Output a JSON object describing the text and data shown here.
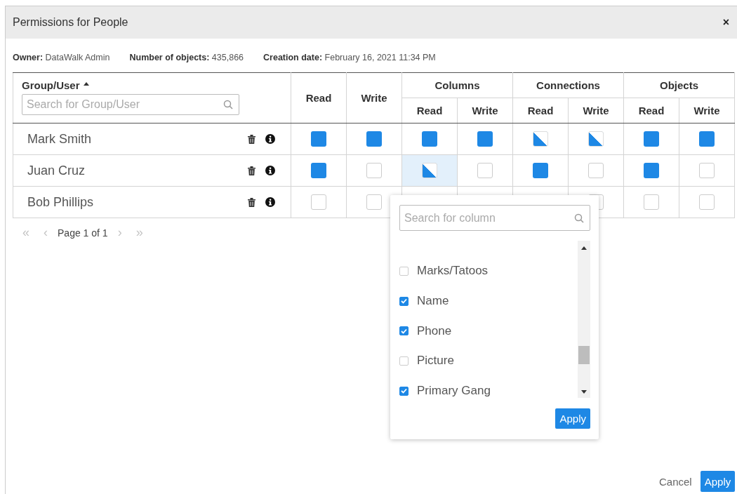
{
  "dialog": {
    "title": "Permissions for People",
    "close": "×"
  },
  "info": [
    {
      "label": "Owner:",
      "value": "DataWalk Admin"
    },
    {
      "label": "Number of objects:",
      "value": "435,866"
    },
    {
      "label": "Creation date:",
      "value": "February 16, 2021 11:34 PM"
    }
  ],
  "table": {
    "group_column": {
      "label": "Group/User",
      "sorted_ascending": true,
      "search_placeholder": "Search for Group/User"
    },
    "columns": [
      {
        "label": "Read"
      },
      {
        "label": "Write"
      },
      {
        "label": "Columns",
        "sub": [
          "Read",
          "Write"
        ]
      },
      {
        "label": "Connections",
        "sub": [
          "Read",
          "Write"
        ]
      },
      {
        "label": "Objects",
        "sub": [
          "Read",
          "Write"
        ]
      }
    ],
    "rows": [
      {
        "name": "Mark Smith",
        "permissions": [
          {
            "checked": true,
            "mixed": false,
            "selected": false
          },
          {
            "checked": true,
            "mixed": false,
            "selected": false
          },
          {
            "checked": true,
            "mixed": false,
            "selected": false
          },
          {
            "checked": true,
            "mixed": false,
            "selected": false
          },
          {
            "checked": true,
            "mixed": true,
            "selected": false
          },
          {
            "checked": true,
            "mixed": true,
            "selected": false
          },
          {
            "checked": true,
            "mixed": false,
            "selected": false
          },
          {
            "checked": true,
            "mixed": false,
            "selected": false
          }
        ]
      },
      {
        "name": "Juan Cruz",
        "permissions": [
          {
            "checked": true,
            "mixed": false,
            "selected": false
          },
          {
            "checked": false,
            "mixed": false,
            "selected": false
          },
          {
            "checked": true,
            "mixed": true,
            "selected": true
          },
          {
            "checked": false,
            "mixed": false,
            "selected": false
          },
          {
            "checked": true,
            "mixed": false,
            "selected": false
          },
          {
            "checked": false,
            "mixed": false,
            "selected": false
          },
          {
            "checked": true,
            "mixed": false,
            "selected": false
          },
          {
            "checked": false,
            "mixed": false,
            "selected": false
          }
        ]
      },
      {
        "name": "Bob Phillips",
        "permissions": [
          {
            "checked": false,
            "mixed": false,
            "selected": false
          },
          {
            "checked": false,
            "mixed": false,
            "selected": false
          }
        ],
        "permissions_right_of_popup": [
          {
            "checked": false,
            "mixed": false,
            "selected": false
          },
          {
            "checked": false,
            "mixed": false,
            "selected": false
          },
          {
            "checked": false,
            "mixed": false,
            "selected": false
          }
        ]
      }
    ]
  },
  "pagination": {
    "first": "«",
    "prev": "‹",
    "page": "Page 1 of 1",
    "next": "›",
    "last": "»",
    "disabled": true
  },
  "column_popup": {
    "search_placeholder": "Search for column",
    "items": [
      {
        "label": "Marks/Tatoos",
        "checked": false
      },
      {
        "label": "Name",
        "checked": true
      },
      {
        "label": "Phone",
        "checked": true
      },
      {
        "label": "Picture",
        "checked": false
      },
      {
        "label": "Primary Gang",
        "checked": true
      }
    ],
    "apply": "Apply"
  },
  "buttons": [
    {
      "label": "Cancel",
      "kind": "link"
    },
    {
      "label": "Apply",
      "kind": "primary"
    }
  ]
}
